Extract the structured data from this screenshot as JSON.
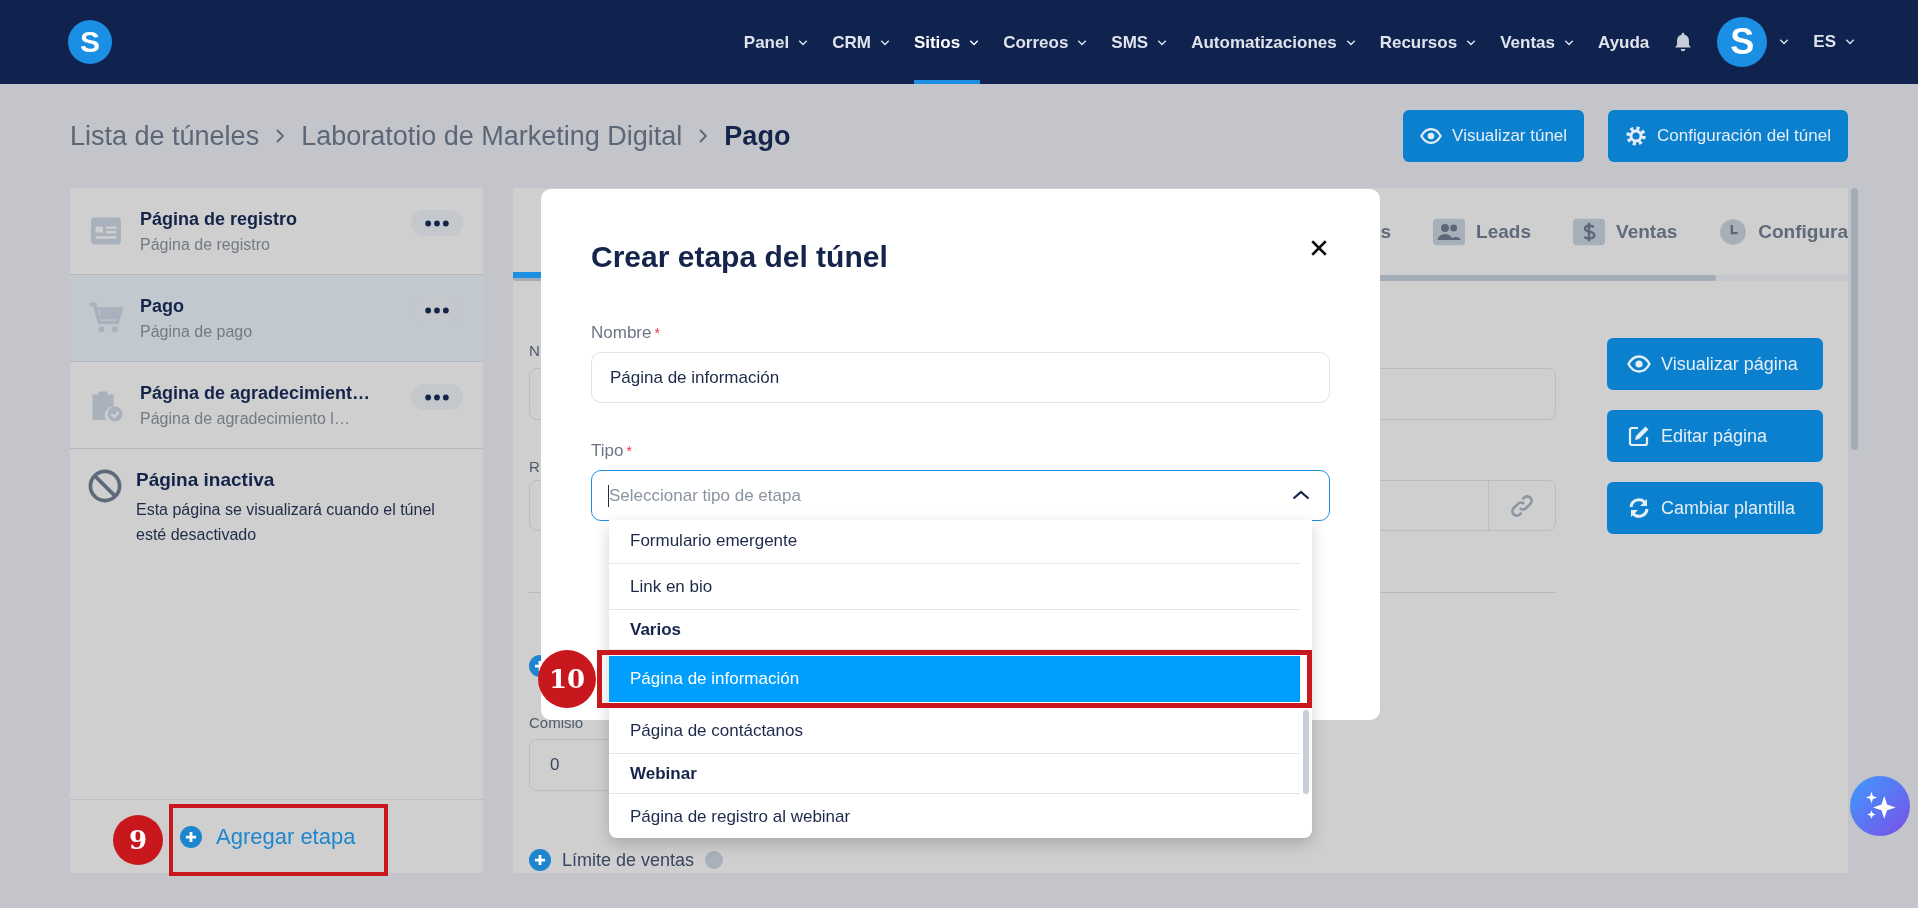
{
  "nav": {
    "logo": "S",
    "menu": [
      {
        "label": "Panel",
        "selected": false,
        "has_menu": true
      },
      {
        "label": "CRM",
        "selected": false,
        "has_menu": true
      },
      {
        "label": "Sitios",
        "selected": true,
        "has_menu": true
      },
      {
        "label": "Correos",
        "selected": false,
        "has_menu": true
      },
      {
        "label": "SMS",
        "selected": false,
        "has_menu": true
      },
      {
        "label": "Automatizaciones",
        "selected": false,
        "has_menu": true
      },
      {
        "label": "Recursos",
        "selected": false,
        "has_menu": true
      },
      {
        "label": "Ventas",
        "selected": false,
        "has_menu": true
      },
      {
        "label": "Ayuda",
        "selected": false,
        "has_menu": false
      }
    ],
    "avatar": "S",
    "language": "ES"
  },
  "breadcrumb": [
    "Lista de túneles",
    "Laboratotio de Marketing Digital",
    "Pago"
  ],
  "header_buttons": [
    {
      "label": "Visualizar túnel"
    },
    {
      "label": "Configuración del túnel"
    }
  ],
  "steps": [
    {
      "title": "Página de registro",
      "subtitle": "Página de registro",
      "selected": false
    },
    {
      "title": "Pago",
      "subtitle": "Página de pago",
      "selected": true
    },
    {
      "title": "Página de agradecimient…",
      "subtitle": "Página de agradecimiento l…",
      "selected": false
    }
  ],
  "inactive_page": {
    "title": "Página inactiva",
    "text": "Esta página se visualizará cuando el túnel esté desactivado"
  },
  "add_step": {
    "label": "Agregar etapa",
    "callout": "9"
  },
  "tabs": [
    {
      "label": "s"
    },
    {
      "label": "Leads"
    },
    {
      "label": "Ventas"
    },
    {
      "label": "Configura"
    }
  ],
  "form": {
    "labels": [
      "N",
      "R"
    ],
    "commission": {
      "label": "Comisio",
      "value": "0"
    },
    "sales_limit": {
      "label": "Límite de ventas"
    }
  },
  "page_buttons": [
    {
      "label": "Visualizar página"
    },
    {
      "label": "Editar página"
    },
    {
      "label": "Cambiar plantilla"
    }
  ],
  "modal": {
    "title": "Crear etapa del túnel",
    "name_field": {
      "label": "Nombre",
      "required_mark": "*",
      "value": "Página de información"
    },
    "type_field": {
      "label": "Tipo",
      "required_mark": "*",
      "placeholder": "Seleccionar tipo de etapa",
      "expanded": true
    },
    "options": [
      {
        "kind": "option",
        "label": "Formulario emergente",
        "selected": false
      },
      {
        "kind": "option",
        "label": "Link en bio",
        "selected": false
      },
      {
        "kind": "group",
        "label": "Varios"
      },
      {
        "kind": "option",
        "label": "Página de información",
        "selected": true,
        "callout": "10"
      },
      {
        "kind": "option",
        "label": "Página de contáctanos",
        "selected": false
      },
      {
        "kind": "group",
        "label": "Webinar"
      },
      {
        "kind": "option",
        "label": "Página de registro al webinar",
        "selected": false
      }
    ]
  }
}
